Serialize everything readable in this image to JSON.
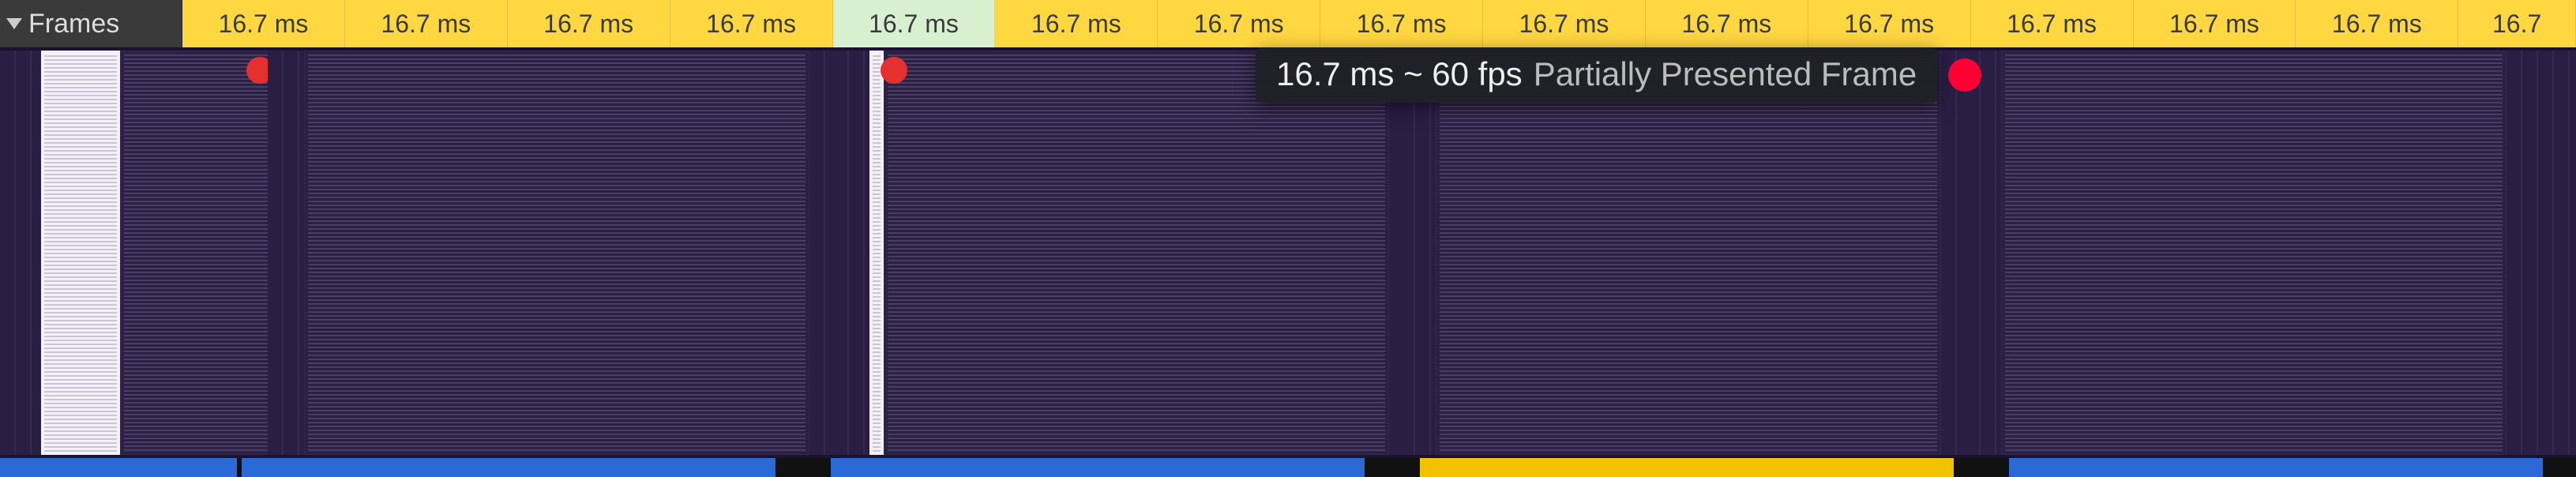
{
  "header": {
    "track_label": "Frames"
  },
  "frames": [
    {
      "label": "16.7 ms",
      "kind": "yellow"
    },
    {
      "label": "16.7 ms",
      "kind": "yellow"
    },
    {
      "label": "16.7 ms",
      "kind": "yellow"
    },
    {
      "label": "16.7 ms",
      "kind": "yellow"
    },
    {
      "label": "16.7 ms",
      "kind": "green"
    },
    {
      "label": "16.7 ms",
      "kind": "yellow"
    },
    {
      "label": "16.7 ms",
      "kind": "yellow"
    },
    {
      "label": "16.7 ms",
      "kind": "yellow"
    },
    {
      "label": "16.7 ms",
      "kind": "yellow"
    },
    {
      "label": "16.7 ms",
      "kind": "yellow"
    },
    {
      "label": "16.7 ms",
      "kind": "yellow"
    },
    {
      "label": "16.7 ms",
      "kind": "yellow"
    },
    {
      "label": "16.7 ms",
      "kind": "yellow"
    },
    {
      "label": "16.7 ms",
      "kind": "yellow"
    },
    {
      "label": "16.7",
      "kind": "yellow"
    }
  ],
  "tooltip": {
    "primary": "16.7 ms ~ 60 fps",
    "secondary": "Partially Presented Frame"
  },
  "layout": {
    "header_cell_w": 242,
    "frame_cell_w": 216,
    "last_frame_cell_w": 156,
    "thumb_w": 700,
    "gap_w": 48
  }
}
